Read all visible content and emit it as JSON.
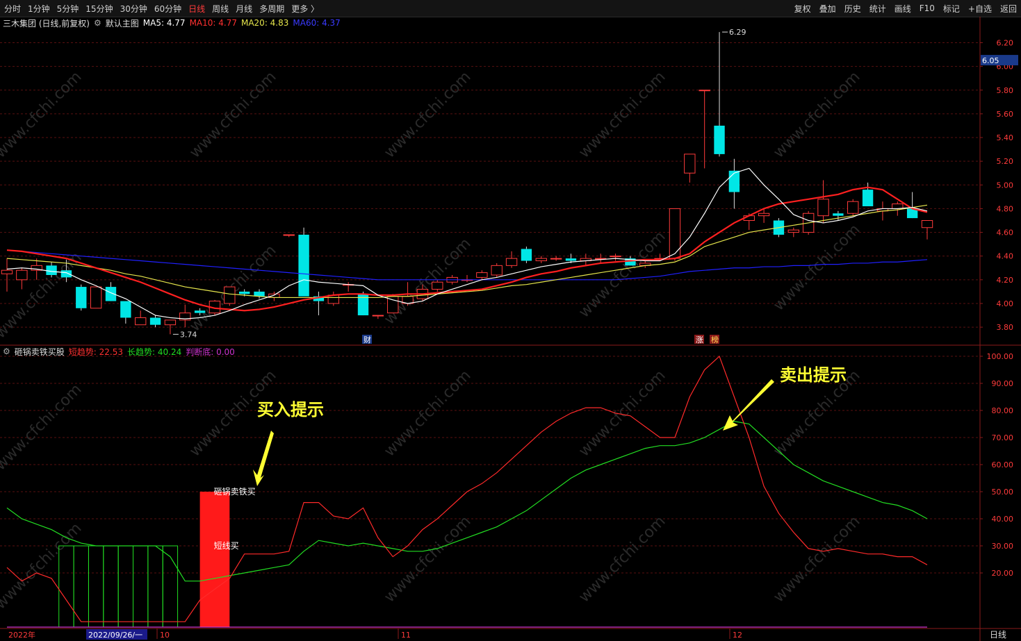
{
  "toolbar": {
    "left": [
      "分时",
      "1分钟",
      "5分钟",
      "15分钟",
      "30分钟",
      "60分钟",
      "日线",
      "周线",
      "月线",
      "多周期",
      "更多 〉"
    ],
    "active_index": 6,
    "right": [
      "复权",
      "叠加",
      "历史",
      "统计",
      "画线",
      "F10",
      "标记",
      "+自选",
      "返回"
    ]
  },
  "main_info": {
    "stock": "三木集团 (日线,前复权)",
    "template": "默认主图",
    "ma5": "MA5: 4.77",
    "ma10": "MA10: 4.77",
    "ma20": "MA20: 4.83",
    "ma60": "MA60: 4.37",
    "current_price": "6.05"
  },
  "indicator_info": {
    "name": "砸锅卖铁买股",
    "short": "短趋势: 22.53",
    "long": "长趋势: 40.24",
    "judge": "判断底: 0.00"
  },
  "annotations": {
    "buy_hint": "买入提示",
    "sell_hint": "卖出提示",
    "bar_label_top": "砸锅卖铁买",
    "bar_label_mid": "短线买",
    "high_label": "6.29",
    "low_label": "3.74",
    "badge_cai": "财",
    "badge_zhang": "涨",
    "badge_bang": "榜"
  },
  "bottom_axis": {
    "year": "2022年",
    "cursor_date": "2022/09/26/一",
    "m10": "10",
    "m11": "11",
    "m12": "12",
    "period": "日线"
  },
  "watermark": "www.cfchi.com",
  "colors": {
    "up": "#ff3b3b",
    "down": "#00e6e6",
    "ma5": "#ffffff",
    "ma10": "#ff2020",
    "ma20": "#e6e64c",
    "ma60": "#2020ff",
    "short_trend": "#ff2a2a",
    "long_trend": "#22dd22",
    "judge": "#cc33cc",
    "hint": "#ffff33"
  },
  "chart_data": [
    {
      "type": "candlestick",
      "title": "三木集团 (日线,前复权)",
      "y_ticks": [
        "3.80",
        "4.00",
        "4.20",
        "4.40",
        "4.60",
        "4.80",
        "5.00",
        "5.20",
        "5.40",
        "5.60",
        "5.80",
        "6.00",
        "6.20"
      ],
      "ylim": [
        3.66,
        6.32
      ],
      "candles": [
        [
          4.25,
          4.38,
          4.1,
          4.28
        ],
        [
          4.2,
          4.3,
          4.12,
          4.28
        ],
        [
          4.28,
          4.38,
          4.2,
          4.32
        ],
        [
          4.32,
          4.35,
          4.22,
          4.24
        ],
        [
          4.28,
          4.37,
          4.18,
          4.22
        ],
        [
          4.14,
          4.16,
          3.94,
          3.96
        ],
        [
          3.96,
          4.14,
          3.96,
          4.14
        ],
        [
          4.14,
          4.18,
          4.02,
          4.02
        ],
        [
          4.02,
          4.02,
          3.83,
          3.88
        ],
        [
          3.82,
          3.94,
          3.82,
          3.88
        ],
        [
          3.88,
          3.9,
          3.8,
          3.82
        ],
        [
          3.82,
          3.86,
          3.74,
          3.86
        ],
        [
          3.86,
          3.99,
          3.8,
          3.92
        ],
        [
          3.94,
          3.96,
          3.9,
          3.92
        ],
        [
          3.92,
          4.03,
          3.9,
          4.02
        ],
        [
          4.0,
          4.14,
          3.98,
          4.14
        ],
        [
          4.1,
          4.12,
          4.06,
          4.08
        ],
        [
          4.1,
          4.12,
          4.04,
          4.06
        ],
        [
          4.05,
          4.1,
          4.02,
          4.08
        ],
        [
          4.58,
          4.58,
          4.56,
          4.58
        ],
        [
          4.58,
          4.64,
          4.18,
          4.06
        ],
        [
          4.06,
          4.1,
          3.9,
          4.02
        ],
        [
          4.0,
          4.1,
          3.98,
          4.07
        ],
        [
          4.16,
          4.18,
          4.1,
          4.16
        ],
        [
          4.08,
          4.1,
          3.9,
          3.9
        ],
        [
          3.9,
          3.9,
          3.87,
          3.9
        ],
        [
          3.92,
          4.08,
          3.92,
          4.06
        ],
        [
          4.0,
          4.18,
          3.98,
          4.06
        ],
        [
          4.04,
          4.16,
          4.02,
          4.12
        ],
        [
          4.12,
          4.2,
          4.1,
          4.18
        ],
        [
          4.18,
          4.24,
          4.16,
          4.22
        ],
        [
          4.2,
          4.24,
          4.18,
          4.2
        ],
        [
          4.22,
          4.28,
          4.2,
          4.26
        ],
        [
          4.24,
          4.34,
          4.22,
          4.32
        ],
        [
          4.32,
          4.44,
          4.3,
          4.38
        ],
        [
          4.46,
          4.48,
          4.34,
          4.36
        ],
        [
          4.36,
          4.4,
          4.34,
          4.38
        ],
        [
          4.38,
          4.4,
          4.36,
          4.38
        ],
        [
          4.38,
          4.42,
          4.34,
          4.36
        ],
        [
          4.36,
          4.42,
          4.32,
          4.38
        ],
        [
          4.38,
          4.42,
          4.34,
          4.38
        ],
        [
          4.4,
          4.42,
          4.36,
          4.4
        ],
        [
          4.38,
          4.4,
          4.32,
          4.32
        ],
        [
          4.32,
          4.36,
          4.3,
          4.34
        ],
        [
          4.38,
          4.42,
          4.36,
          4.38
        ],
        [
          4.38,
          4.8,
          4.36,
          4.8
        ],
        [
          5.1,
          5.26,
          5.02,
          5.26
        ],
        [
          5.8,
          5.8,
          5.14,
          5.8
        ],
        [
          5.5,
          6.29,
          5.24,
          5.26
        ],
        [
          5.12,
          5.22,
          4.8,
          4.94
        ],
        [
          4.7,
          4.76,
          4.62,
          4.74
        ],
        [
          4.74,
          4.8,
          4.68,
          4.76
        ],
        [
          4.7,
          4.72,
          4.56,
          4.58
        ],
        [
          4.6,
          4.64,
          4.56,
          4.62
        ],
        [
          4.6,
          4.78,
          4.58,
          4.76
        ],
        [
          4.74,
          5.04,
          4.68,
          4.88
        ],
        [
          4.76,
          4.78,
          4.7,
          4.74
        ],
        [
          4.76,
          4.88,
          4.74,
          4.86
        ],
        [
          4.96,
          5.02,
          4.82,
          4.82
        ],
        [
          4.78,
          4.86,
          4.7,
          4.8
        ],
        [
          4.8,
          4.86,
          4.74,
          4.84
        ],
        [
          4.8,
          4.94,
          4.72,
          4.72
        ],
        [
          4.64,
          4.7,
          4.54,
          4.7
        ]
      ],
      "ma5": [
        4.29,
        4.3,
        4.29,
        4.27,
        4.26,
        4.2,
        4.15,
        4.09,
        4.04,
        3.97,
        3.9,
        3.88,
        3.87,
        3.88,
        3.9,
        3.94,
        3.99,
        4.03,
        4.07,
        4.15,
        4.2,
        4.18,
        4.17,
        4.16,
        4.15,
        4.07,
        4.03,
        4.0,
        4.02,
        4.08,
        4.12,
        4.16,
        4.2,
        4.22,
        4.25,
        4.28,
        4.31,
        4.33,
        4.35,
        4.36,
        4.37,
        4.38,
        4.37,
        4.36,
        4.36,
        4.42,
        4.56,
        4.76,
        4.98,
        5.1,
        5.14,
        5.0,
        4.88,
        4.75,
        4.7,
        4.68,
        4.7,
        4.73,
        4.78,
        4.8,
        4.8,
        4.81,
        4.78
      ],
      "ma10": [
        4.45,
        4.44,
        4.42,
        4.4,
        4.38,
        4.34,
        4.3,
        4.26,
        4.22,
        4.18,
        4.13,
        4.08,
        4.03,
        3.99,
        3.96,
        3.95,
        3.94,
        3.95,
        3.97,
        4.0,
        4.03,
        4.05,
        4.07,
        4.08,
        4.08,
        4.07,
        4.07,
        4.08,
        4.08,
        4.09,
        4.1,
        4.11,
        4.12,
        4.15,
        4.18,
        4.22,
        4.25,
        4.27,
        4.3,
        4.32,
        4.34,
        4.35,
        4.36,
        4.37,
        4.37,
        4.38,
        4.42,
        4.52,
        4.6,
        4.68,
        4.74,
        4.8,
        4.84,
        4.86,
        4.88,
        4.9,
        4.92,
        4.96,
        4.98,
        4.96,
        4.88,
        4.8,
        4.77
      ],
      "ma20": [
        4.38,
        4.37,
        4.36,
        4.35,
        4.34,
        4.32,
        4.3,
        4.28,
        4.25,
        4.23,
        4.2,
        4.17,
        4.14,
        4.12,
        4.1,
        4.08,
        4.07,
        4.06,
        4.05,
        4.05,
        4.05,
        4.05,
        4.05,
        4.05,
        4.05,
        4.05,
        4.06,
        4.06,
        4.07,
        4.08,
        4.09,
        4.1,
        4.11,
        4.13,
        4.15,
        4.16,
        4.18,
        4.2,
        4.22,
        4.24,
        4.26,
        4.28,
        4.3,
        4.32,
        4.33,
        4.35,
        4.4,
        4.48,
        4.52,
        4.56,
        4.6,
        4.62,
        4.64,
        4.66,
        4.68,
        4.7,
        4.72,
        4.74,
        4.76,
        4.78,
        4.79,
        4.81,
        4.83
      ],
      "ma60": [
        4.45,
        4.44,
        4.43,
        4.42,
        4.41,
        4.4,
        4.39,
        4.38,
        4.37,
        4.36,
        4.35,
        4.34,
        4.33,
        4.32,
        4.31,
        4.3,
        4.29,
        4.28,
        4.27,
        4.26,
        4.25,
        4.24,
        4.23,
        4.22,
        4.21,
        4.2,
        4.2,
        4.2,
        4.2,
        4.2,
        4.2,
        4.2,
        4.2,
        4.2,
        4.2,
        4.2,
        4.2,
        4.2,
        4.2,
        4.2,
        4.2,
        4.2,
        4.21,
        4.22,
        4.23,
        4.25,
        4.27,
        4.28,
        4.29,
        4.3,
        4.3,
        4.31,
        4.31,
        4.32,
        4.32,
        4.33,
        4.33,
        4.34,
        4.34,
        4.35,
        4.35,
        4.36,
        4.37
      ]
    },
    {
      "type": "line",
      "title": "砸锅卖铁买股",
      "y_ticks": [
        "20.00",
        "30.00",
        "40.00",
        "50.00",
        "60.00",
        "70.00",
        "80.00",
        "90.00",
        "100.00"
      ],
      "ylim": [
        0,
        100
      ],
      "series": [
        {
          "name": "短趋势",
          "values": [
            22,
            17,
            20,
            18,
            10,
            2,
            2,
            2,
            2,
            2,
            2,
            2,
            2,
            10,
            14,
            18,
            27,
            27,
            27,
            28,
            46,
            46,
            41,
            40,
            44,
            33,
            26,
            30,
            36,
            40,
            45,
            50,
            53,
            57,
            62,
            67,
            72,
            76,
            79,
            81,
            81,
            79,
            78,
            74,
            70,
            70,
            85,
            95,
            100,
            85,
            70,
            52,
            42,
            35,
            29,
            28,
            29,
            28,
            27,
            27,
            26,
            26,
            23
          ]
        },
        {
          "name": "长趋势",
          "values": [
            44,
            40,
            38,
            36,
            33,
            31,
            30,
            30,
            30,
            30,
            30,
            26,
            17,
            17,
            18,
            19,
            20,
            21,
            22,
            23,
            28,
            32,
            31,
            30,
            31,
            30,
            29,
            28,
            28,
            29,
            31,
            33,
            35,
            37,
            40,
            43,
            47,
            51,
            55,
            58,
            60,
            62,
            64,
            66,
            67,
            67,
            68,
            70,
            73,
            76,
            75,
            70,
            65,
            60,
            57,
            54,
            52,
            50,
            48,
            46,
            45,
            43,
            40
          ]
        },
        {
          "name": "判断底",
          "values": [
            0,
            0,
            0,
            0,
            0,
            0,
            0,
            0,
            0,
            0,
            0,
            0,
            0,
            0,
            0,
            0,
            0,
            0,
            0,
            0,
            0,
            0,
            0,
            0,
            0,
            0,
            0,
            0,
            0,
            0,
            0,
            0,
            0,
            0,
            0,
            0,
            0,
            0,
            0,
            0,
            0,
            0,
            0,
            0,
            0,
            0,
            0,
            0,
            0,
            0,
            0,
            0,
            0,
            0,
            0,
            0,
            0,
            0,
            0,
            0,
            0,
            0,
            0
          ]
        }
      ],
      "green_bars": {
        "from_index": 4,
        "to_index": 11,
        "value": 30
      },
      "red_bar": {
        "index": 14,
        "value": 50
      }
    }
  ]
}
